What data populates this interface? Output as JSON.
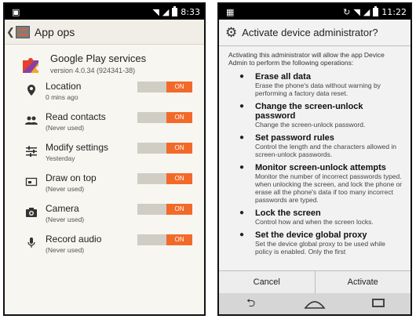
{
  "left": {
    "status_time": "8:33",
    "title": "App ops",
    "app": {
      "name": "Google Play services",
      "version": "version 4.0.34 (924341-38)"
    },
    "ops": [
      {
        "label": "Location",
        "sub": "0 mins ago",
        "toggle": "ON",
        "icon": "location-pin-icon"
      },
      {
        "label": "Read contacts",
        "sub": "(Never used)",
        "toggle": "ON",
        "icon": "contacts-icon"
      },
      {
        "label": "Modify settings",
        "sub": "Yesterday",
        "toggle": "ON",
        "icon": "settings-sliders-icon"
      },
      {
        "label": "Draw on top",
        "sub": "(Never used)",
        "toggle": "ON",
        "icon": "draw-on-top-icon"
      },
      {
        "label": "Camera",
        "sub": "(Never used)",
        "toggle": "ON",
        "icon": "camera-icon"
      },
      {
        "label": "Record audio",
        "sub": "(Never used)",
        "toggle": "ON",
        "icon": "microphone-icon"
      }
    ],
    "toggle_color": "#f26a2a"
  },
  "right": {
    "status_time": "11:22",
    "title": "Activate device administrator?",
    "intro": "Activating this administrator will allow the app Device Admin to perform the following operations:",
    "permissions": [
      {
        "title": "Erase all data",
        "desc": "Erase the phone's data without warning by performing a factory data reset."
      },
      {
        "title": "Change the screen-unlock password",
        "desc": "Change the screen-unlock password."
      },
      {
        "title": "Set password rules",
        "desc": "Control the length and the characters allowed in screen-unlock passwords."
      },
      {
        "title": "Monitor screen-unlock attempts",
        "desc": "Monitor the number of incorrect passwords typed. when unlocking the screen, and lock the phone or erase all the phone's data if too many incorrect passwords are typed."
      },
      {
        "title": "Lock the screen",
        "desc": "Control how and when the screen locks."
      },
      {
        "title": "Set the device global proxy",
        "desc": "Set the device global proxy to be used while policy is enabled. Only the first"
      }
    ],
    "buttons": {
      "cancel": "Cancel",
      "activate": "Activate"
    }
  }
}
